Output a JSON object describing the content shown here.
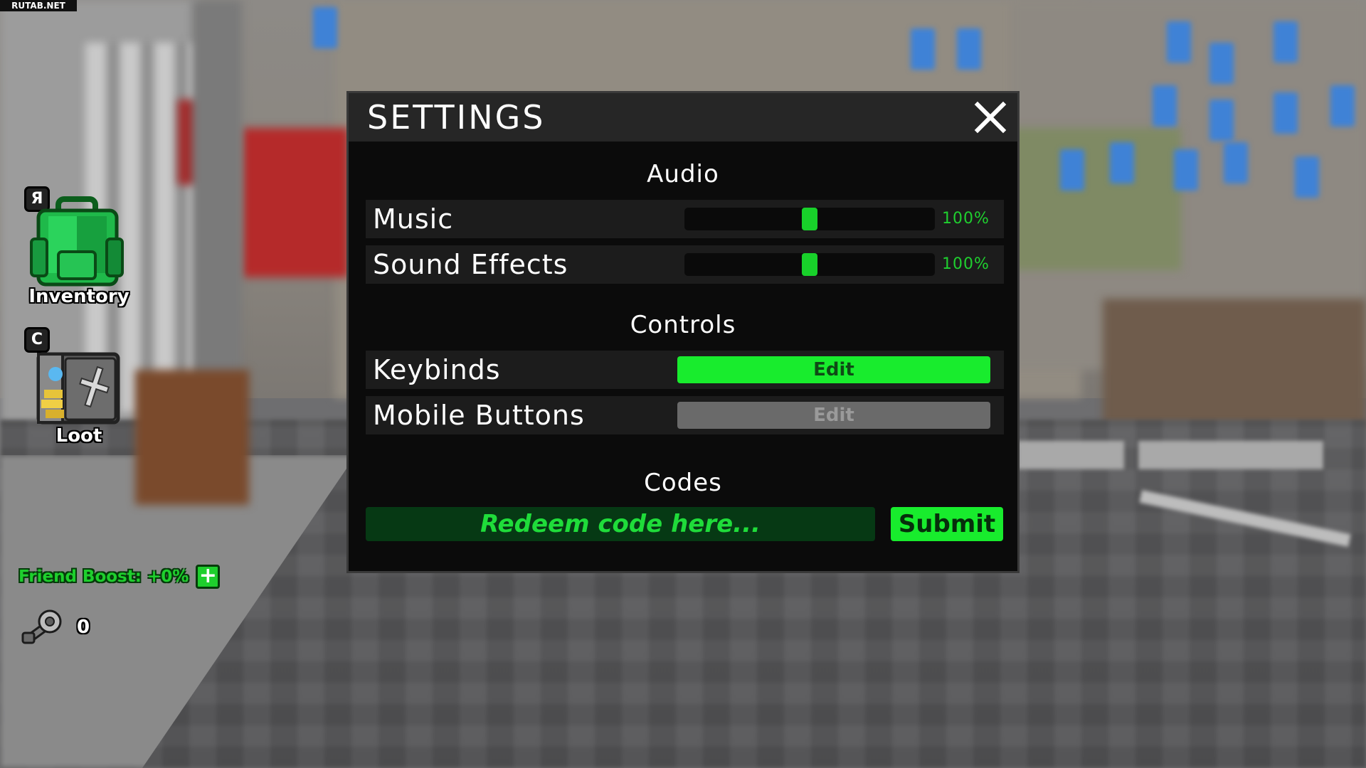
{
  "watermark": "RUTAB.NET",
  "hud": {
    "inventory": {
      "key": "Я",
      "label": "Inventory",
      "icon": "backpack-icon"
    },
    "loot": {
      "key": "C",
      "label": "Loot",
      "icon": "safe-icon"
    },
    "friend_boost": {
      "text": "Friend Boost: +0%",
      "add_label": "+"
    },
    "wrenches": {
      "icon": "wrench-icon",
      "count": "0"
    }
  },
  "settings": {
    "title": "SETTINGS",
    "close_icon": "close-icon",
    "audio": {
      "heading": "Audio",
      "music": {
        "label": "Music",
        "value_text": "100%",
        "level": 0.5
      },
      "sound_effects": {
        "label": "Sound Effects",
        "value_text": "100%",
        "level": 0.5
      }
    },
    "controls": {
      "heading": "Controls",
      "keybinds": {
        "label": "Keybinds",
        "button": "Edit",
        "enabled": true
      },
      "mobile_buttons": {
        "label": "Mobile Buttons",
        "button": "Edit",
        "enabled": false
      }
    },
    "codes": {
      "heading": "Codes",
      "input_value": "",
      "placeholder": "Redeem code here...",
      "submit": "Submit"
    }
  },
  "colors": {
    "accent_green": "#18ec2d",
    "value_green": "#1fcf2f",
    "panel_bg": "#0b0b0b",
    "header_bg": "#262626",
    "row_bg": "#1c1c1c",
    "disabled_gray": "#6a6a6a"
  }
}
